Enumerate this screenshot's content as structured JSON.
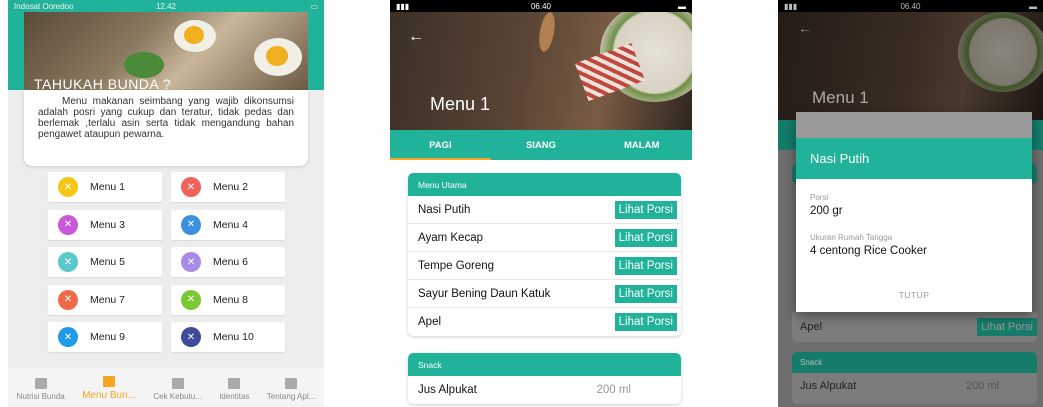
{
  "screen1": {
    "status": {
      "carrier": "Indosat Ooredoo",
      "time": "12.42"
    },
    "hero_title": "TAHUKAH BUNDA ?",
    "info_text": "Menu makanan seimbang yang wajib dikonsumsi adalah posri yang cukup dan teratur, tidak pedas dan berlemak ,terlalu asin serta tidak mengandung bahan pengawet ataupun pewarna.",
    "menus": [
      {
        "label": "Menu 1",
        "color": "#f5c518"
      },
      {
        "label": "Menu 2",
        "color": "#f0625a"
      },
      {
        "label": "Menu 3",
        "color": "#c85ad8"
      },
      {
        "label": "Menu 4",
        "color": "#3d8fe0"
      },
      {
        "label": "Menu 5",
        "color": "#5bc9c9"
      },
      {
        "label": "Menu 6",
        "color": "#a88ae8"
      },
      {
        "label": "Menu 7",
        "color": "#f06a4a"
      },
      {
        "label": "Menu 8",
        "color": "#7cc832"
      },
      {
        "label": "Menu 9",
        "color": "#1e9be8"
      },
      {
        "label": "Menu 10",
        "color": "#3f4a9a"
      }
    ],
    "bottom_nav": [
      {
        "label": "Nutrisi Bunda",
        "icon": "book-icon",
        "active": false
      },
      {
        "label": "Menu Bun...",
        "icon": "menu-book-icon",
        "active": true
      },
      {
        "label": "Cek Kebutu...",
        "icon": "check-icon",
        "active": false
      },
      {
        "label": "Identitas",
        "icon": "person-icon",
        "active": false
      },
      {
        "label": "Tentang Apl...",
        "icon": "help-icon",
        "active": false
      }
    ]
  },
  "screen2": {
    "status": {
      "time": "06.40"
    },
    "title": "Menu 1",
    "tabs": [
      "PAGI",
      "SIANG",
      "MALAM"
    ],
    "main_section": {
      "header": "Menu Utama",
      "items": [
        "Nasi Putih",
        "Ayam Kecap",
        "Tempe Goreng",
        "Sayur Bening Daun Katuk",
        "Apel"
      ],
      "button_label": "Lihat Porsi"
    },
    "snack_section": {
      "header": "Snack",
      "items": [
        {
          "name": "Jus Alpukat",
          "value": "200 ml"
        }
      ]
    }
  },
  "screen3": {
    "status": {
      "time": "06.40"
    },
    "title": "Menu 1",
    "dialog": {
      "title": "Nasi Putih",
      "porsi_label": "Porsi",
      "porsi_value": "200 gr",
      "urt_label": "Ukuran Rumah Tangga",
      "urt_value": "4 centong Rice Cooker",
      "close_label": "TUTUP"
    },
    "bg_item": "Apel",
    "bg_button": "Lihat Porsi",
    "bg_snack_header": "Snack",
    "bg_snack_item": "Jus Alpukat",
    "bg_snack_value": "200 ml"
  }
}
